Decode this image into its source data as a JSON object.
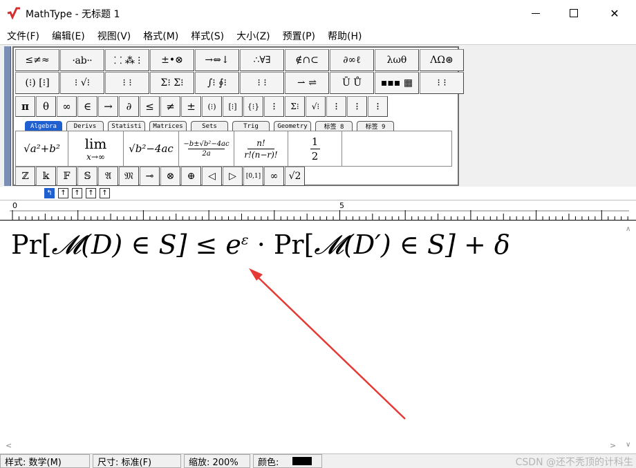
{
  "window": {
    "title": "MathType - 无标题 1",
    "minimize": "—",
    "maximize": "☐",
    "close": "✕"
  },
  "menu": [
    "文件(F)",
    "编辑(E)",
    "视图(V)",
    "格式(M)",
    "样式(S)",
    "大小(Z)",
    "预置(P)",
    "帮助(H)"
  ],
  "palette": {
    "row1": [
      "≤≠≈",
      "⸱ab⸱⸱",
      "⸬ ⁂ ⁝",
      "±•⊗",
      "→⇔↓",
      "∴∀∃",
      "∉∩⊂",
      "∂∞ℓ",
      "λωθ",
      "ΛΩ⊛"
    ],
    "row2": [
      "(⁝) [⁝]",
      "⁝ √⁝",
      "⁝ ⁝",
      "Σ⁝ Σ⁝",
      "∫⁝ ∮⁝",
      "⁝ ⁝",
      "⇀ ⇌",
      "Ū Ů",
      "▪▪▪ ▦",
      "⁝ ⁝"
    ],
    "row3": [
      "π",
      "θ",
      "∞",
      "∈",
      "→",
      "∂",
      "≤",
      "≠",
      "±",
      "(⁝)",
      "[⁝]",
      "{⁝}",
      "⁝",
      "Σ⁝",
      "√⁝",
      "⁝",
      "⁝",
      "⁝"
    ],
    "tabs": [
      "Algebra",
      "Derivs",
      "Statisti",
      "Matrices",
      "Sets",
      "Trig",
      "Geometry",
      "标签 8",
      "标签 9"
    ],
    "templates": {
      "t1": "√a²+b²",
      "t2_top": "lim",
      "t2_bottom": "x→∞",
      "t3": "√b²−4ac",
      "t4_top": "−b±√b²−4ac",
      "t4_bottom": "2a",
      "t5_top": "n!",
      "t5_bottom": "r!(n−r)!",
      "t6_top": "1",
      "t6_bottom": "2"
    },
    "row5": [
      "ℤ",
      "𝕜",
      "𝔽",
      "𝕊",
      "𝔄",
      "𝔐",
      "⊸",
      "⊗",
      "⊕",
      "◁",
      "▷",
      "[0,1]",
      "∞",
      "√2"
    ]
  },
  "nav_buttons": [
    "↰",
    "↑",
    "↑",
    "↑",
    "↑"
  ],
  "ruler": {
    "label0": "0",
    "label5": "5"
  },
  "formula": "Pr[𝓜(D) ∈ S] ≤ e^ε · Pr[𝓜(D′) ∈ S] + δ",
  "formula_parts": {
    "a": "Pr[",
    "m1": "𝓜",
    "b": "(D) ∈ S] ≤ ",
    "e": "e",
    "eps": "ε",
    "c": " · Pr[",
    "m2": "𝓜",
    "d": "(D′) ∈ S] + δ"
  },
  "status": {
    "style": "样式: 数学(M)",
    "size": "尺寸: 标准(F)",
    "zoom": "缩放: 200%",
    "color_label": "颜色:",
    "color_value": "#000000"
  },
  "watermark": "CSDN @还不秃顶的计科生",
  "colors": {
    "arrow": "#e53935",
    "active_tab": "#1f5fcf",
    "strip": "#7a8fb3"
  }
}
